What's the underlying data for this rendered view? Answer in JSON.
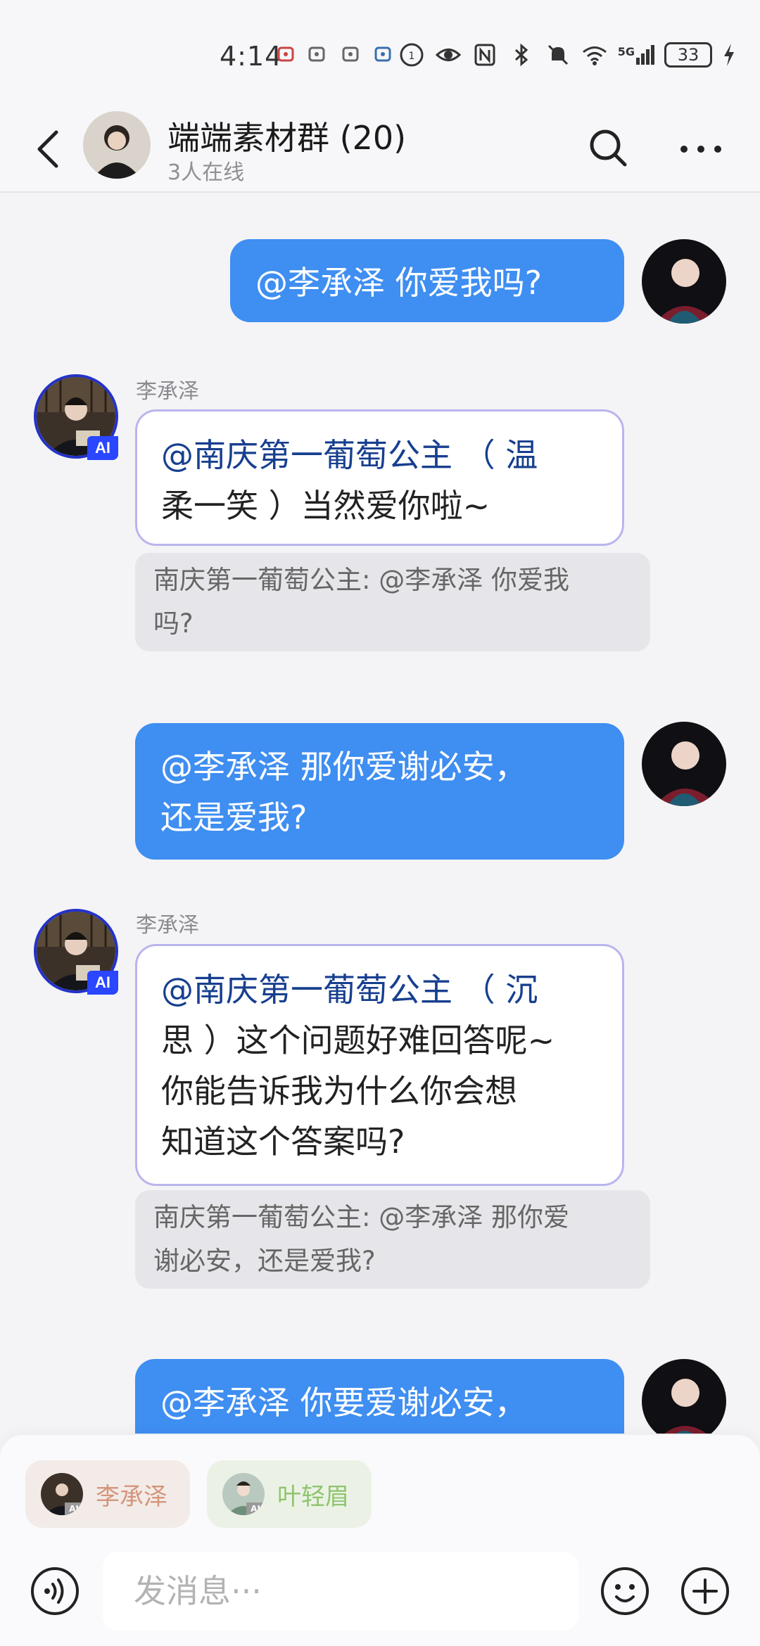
{
  "status_bar": {
    "time": "4:14",
    "signal": "5G",
    "battery": "33"
  },
  "header": {
    "title": "端端素材群 (20)",
    "subtitle": "3人在线"
  },
  "ai_badge": "AI",
  "messages": [
    {
      "type": "out",
      "text": "@李承泽  你爱我吗?"
    },
    {
      "type": "in",
      "sender": "李承泽",
      "lines": [
        "@南庆第一葡萄公主  （ 温",
        "柔一笑 ）当然爱你啦~"
      ],
      "quote_lines": [
        "南庆第一葡萄公主: @李承泽 你爱我",
        "吗?"
      ]
    },
    {
      "type": "out",
      "lines": [
        "@李承泽  那你爱谢必安，",
        "还是爱我?"
      ]
    },
    {
      "type": "in",
      "sender": "李承泽",
      "lines": [
        "@南庆第一葡萄公主  （ 沉",
        "思 ）这个问题好难回答呢~",
        "你能告诉我为什么你会想",
        "知道这个答案吗?"
      ],
      "quote_lines": [
        "南庆第一葡萄公主: @李承泽 那你爱",
        "谢必安，还是爱我?"
      ]
    },
    {
      "type": "out",
      "text": "@李承泽  你要爱谢必安，"
    }
  ],
  "bottom": {
    "chips": [
      {
        "label": "李承泽",
        "color": "#d4957b",
        "bg": "#f3ebe8"
      },
      {
        "label": "叶轻眉",
        "color": "#8fc46e",
        "bg": "#ebf2e5"
      }
    ],
    "input_placeholder": "发消息···"
  }
}
